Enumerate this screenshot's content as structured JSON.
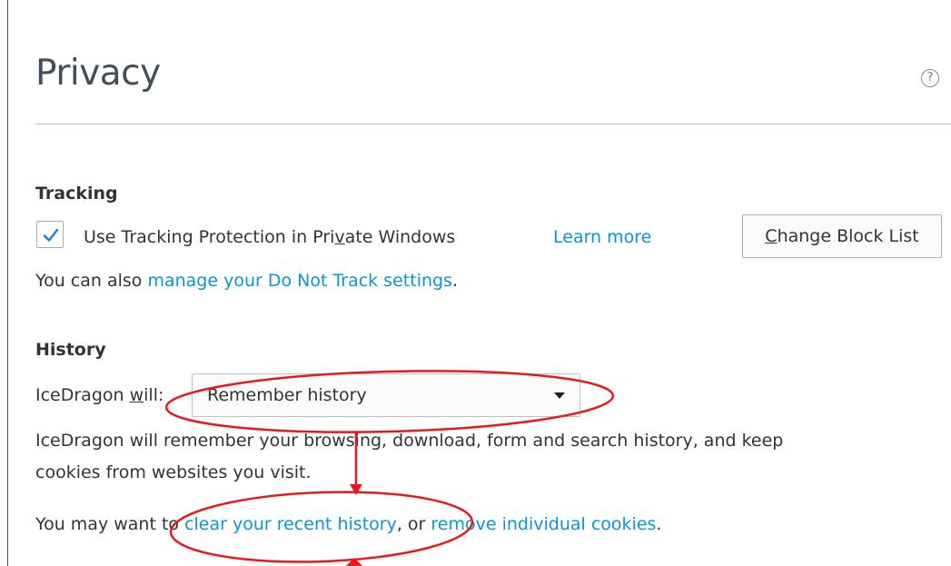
{
  "page": {
    "title": "Privacy",
    "help_icon": "?"
  },
  "tracking": {
    "heading": "Tracking",
    "checkbox_checked": true,
    "checkbox_label_pre": "Use Tracking Protection in Pri",
    "checkbox_label_access": "v",
    "checkbox_label_post": "ate Windows",
    "learn_more": "Learn more",
    "change_block_list_access": "C",
    "change_block_list_rest": "hange Block List",
    "dnt_prefix": "You can also ",
    "dnt_link": "manage your Do Not Track settings",
    "dnt_suffix": "."
  },
  "history": {
    "heading": "History",
    "will_label_pre": "IceDragon ",
    "will_label_access": "w",
    "will_label_post": "ill:",
    "select_value": "Remember history",
    "description_line1": "IceDragon will remember your browsing, download, form and search history, and keep",
    "description_line2": "cookies from websites you visit.",
    "clear_prefix": "You may want to ",
    "clear_link": "clear your recent history",
    "clear_middle": ", or ",
    "cookies_link": "remove individual cookies",
    "clear_suffix": "."
  },
  "colors": {
    "link": "#0a95d7",
    "annotation": "#e8191e",
    "title": "#424f5a"
  }
}
